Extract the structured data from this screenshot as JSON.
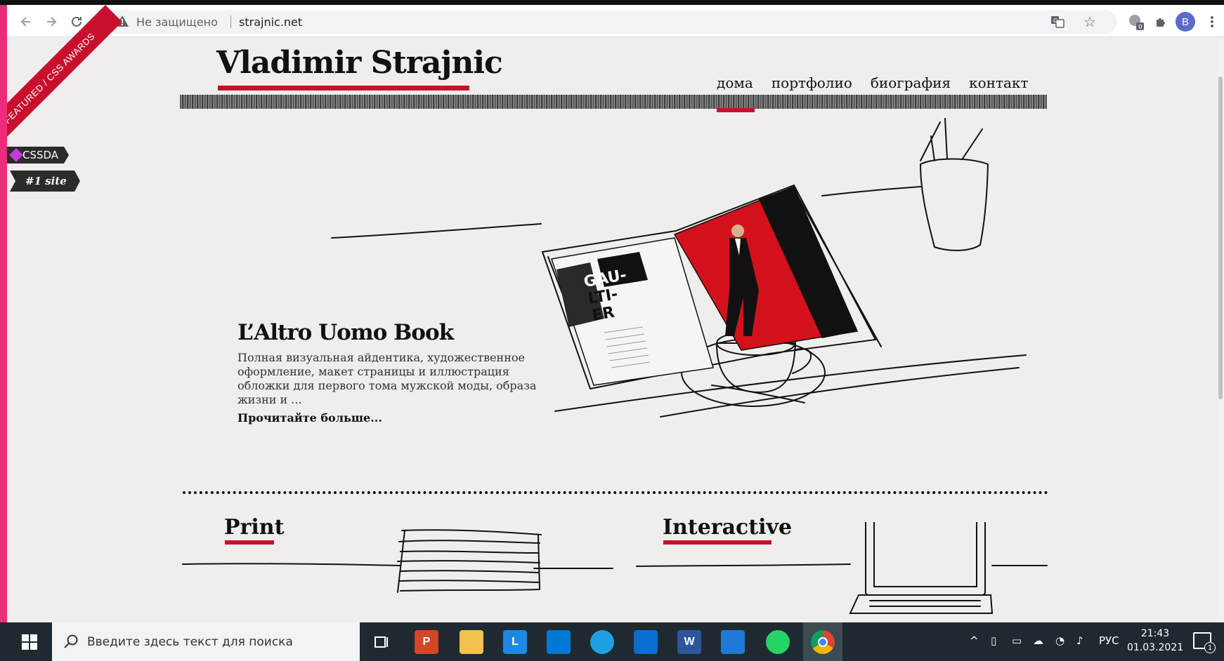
{
  "browser": {
    "security_label": "Не защищено",
    "url": "strajnic.net",
    "profile_initial": "B"
  },
  "badges": {
    "ribbon_text": "FEATURED / CSS AWARDS",
    "cssda_label": "CSSDA",
    "cssda_rank": "#1 site"
  },
  "site": {
    "logo": "Vladimir Strajnic",
    "nav": [
      {
        "label": "дома"
      },
      {
        "label": "портфолио"
      },
      {
        "label": "биография"
      },
      {
        "label": "контакт"
      }
    ]
  },
  "hero": {
    "magazine_text": "GAU-\nLTI-\nER",
    "title": "L’Altro Uomo Book",
    "description": "Полная визуальная айдентика, художественное оформление, макет страницы и иллюстрация обложки для первого тома мужской моды, образа жизни и ...",
    "more_link": "Прочитайте больше..."
  },
  "sections": {
    "print": "Print",
    "interactive": "Interactive"
  },
  "taskbar": {
    "search_placeholder": "Введите здесь текст для поиска",
    "language": "РУС",
    "time": "21:43",
    "date": "01.03.2021",
    "notification_count": "1",
    "apps": [
      {
        "name": "powerpoint",
        "glyph": "P",
        "color": "#d24726"
      },
      {
        "name": "file-explorer",
        "glyph": "",
        "color": "#f2c14e"
      },
      {
        "name": "lingvo",
        "glyph": "L",
        "color": "#1e88e5"
      },
      {
        "name": "store",
        "glyph": "",
        "color": "#0078d7"
      },
      {
        "name": "edge",
        "glyph": "",
        "color": "#1fa0e3"
      },
      {
        "name": "mail",
        "glyph": "",
        "color": "#0a6ed1"
      },
      {
        "name": "word",
        "glyph": "W",
        "color": "#2b579a"
      },
      {
        "name": "photos",
        "glyph": "",
        "color": "#1d7bd7"
      },
      {
        "name": "whatsapp",
        "glyph": "",
        "color": "#25d366"
      },
      {
        "name": "chrome",
        "glyph": "",
        "color": "#db4437"
      }
    ]
  },
  "colors": {
    "accent_red": "#c8102e",
    "page_bg": "#efeeed",
    "outer_pink": "#ef2b7c"
  }
}
